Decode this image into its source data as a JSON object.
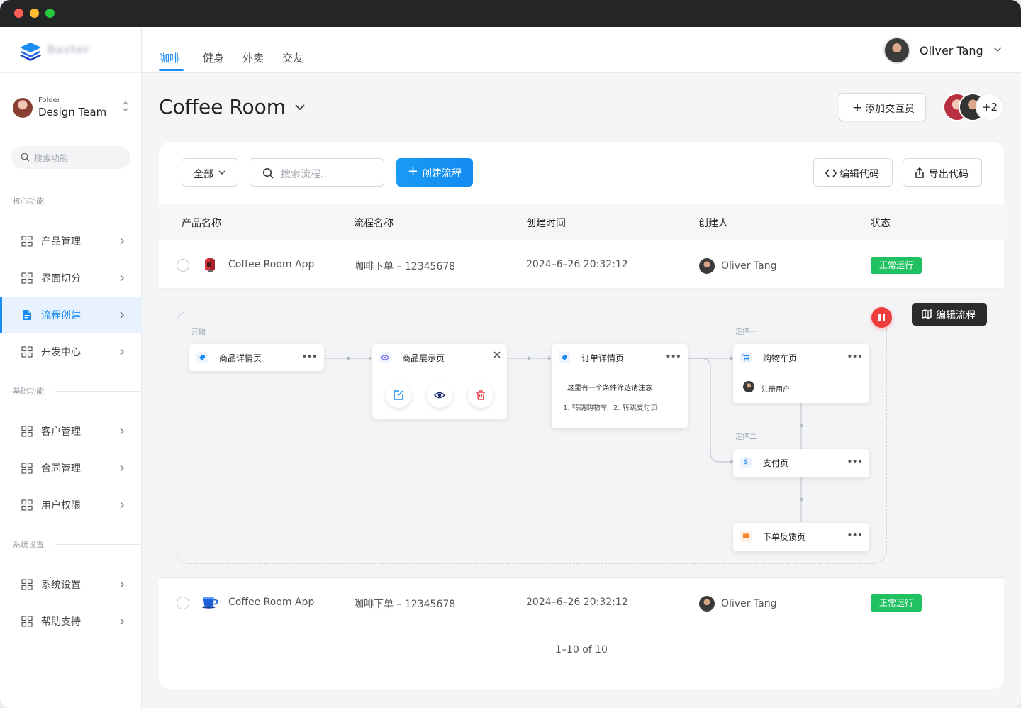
{
  "app": {
    "logo_text": "Baxter"
  },
  "sidebar": {
    "folder_caption": "Folder",
    "folder_name": "Design Team",
    "search_placeholder": "搜索功能",
    "sections": [
      "核心功能",
      "基础功能",
      "系统设置"
    ],
    "items": [
      {
        "label": "产品管理",
        "active": false
      },
      {
        "label": "界面切分",
        "active": false
      },
      {
        "label": "流程创建",
        "active": true
      },
      {
        "label": "开发中心",
        "active": false
      },
      {
        "label": "客户管理",
        "active": false
      },
      {
        "label": "合同管理",
        "active": false
      },
      {
        "label": "用户权限",
        "active": false
      },
      {
        "label": "系统设置",
        "active": false
      },
      {
        "label": "帮助支持",
        "active": false
      }
    ]
  },
  "header": {
    "tabs": [
      "咖啡",
      "健身",
      "外卖",
      "交友"
    ],
    "active_tab": "咖啡",
    "user_name": "Oliver Tang"
  },
  "page": {
    "title": "Coffee Room",
    "add_member_label": "添加交互员",
    "member_overflow": "+2"
  },
  "toolbar": {
    "filter_label": "全部",
    "search_placeholder": "搜索流程..",
    "create_label": "创建流程",
    "edit_code_label": "编辑代码",
    "export_code_label": "导出代码"
  },
  "table": {
    "columns": [
      "产品名称",
      "流程名称",
      "创建时间",
      "创建人",
      "状态"
    ],
    "rows": [
      {
        "product": "Coffee Room App",
        "flow": "咖啡下单 – 12345678",
        "created": "2024–6–26 20:32:12",
        "creator": "Oliver Tang",
        "status": "正常运行"
      },
      {
        "product": "Coffee Room App",
        "flow": "咖啡下单 – 12345678",
        "created": "2024–6–26 20:32:12",
        "creator": "Oliver Tang",
        "status": "正常运行"
      }
    ]
  },
  "flow": {
    "start_label": "开始",
    "choice1_label": "选择一",
    "choice2_label": "选择二",
    "edit_flow_label": "编辑流程",
    "nodes": {
      "product_detail": "商品详情页",
      "product_display": "商品展示页",
      "order_detail": "订单详情页",
      "order_note": "这里有一个条件筛选请注意",
      "order_opt1": "1. 转跳购物车",
      "order_opt2": "2. 转跳支付页",
      "cart": "购物车页",
      "cart_user": "注册用户",
      "payment": "支付页",
      "feedback": "下单反馈页"
    }
  },
  "pagination": {
    "text": "1–10 of 10"
  },
  "colors": {
    "accent": "#1a8cf2",
    "success": "#20c160",
    "danger": "#ee3b3b",
    "dark": "#2a2b2d"
  }
}
